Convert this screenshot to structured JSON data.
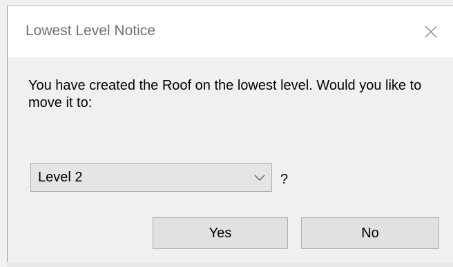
{
  "dialog": {
    "title": "Lowest Level Notice",
    "message": "You have created the Roof on the lowest level.  Would you like to move it to:",
    "question_mark": "?",
    "level_select": {
      "selected": "Level 2"
    },
    "buttons": {
      "yes_label": "Yes",
      "no_label": "No"
    },
    "icons": {
      "close": "close-icon",
      "dropdown": "chevron-down-icon"
    }
  }
}
